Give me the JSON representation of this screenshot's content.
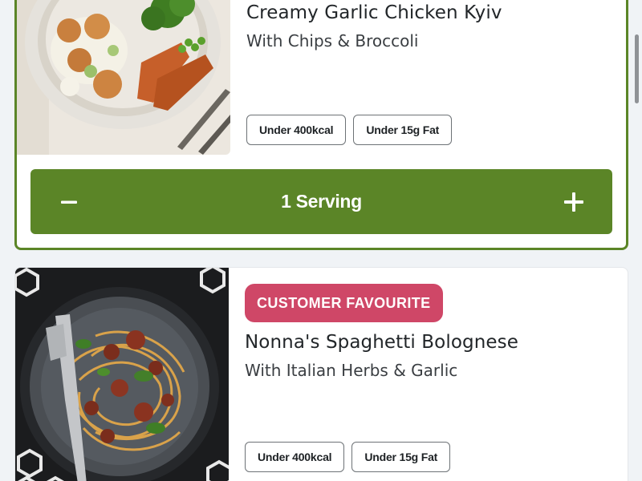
{
  "meals": [
    {
      "image_icon": "chicken-kyiv-plate-image",
      "title": "Creamy Garlic Chicken Kyiv",
      "subtitle": "With Chips & Broccoli",
      "tags": [
        "Under 400kcal",
        "Under 15g Fat"
      ],
      "selected": true,
      "servings_label": "1 Serving"
    },
    {
      "image_icon": "spaghetti-bolognese-plate-image",
      "badge": "CUSTOMER FAVOURITE",
      "title": "Nonna's Spaghetti Bolognese",
      "subtitle": "With Italian Herbs & Garlic",
      "tags": [
        "Under 400kcal",
        "Under 15g Fat"
      ],
      "selected": false
    }
  ],
  "icons": {
    "decrease": "minus-icon",
    "increase": "plus-icon"
  },
  "colors": {
    "accent_green": "#5b8527",
    "badge_pink": "#cf4767",
    "page_background": "#f0f3f6"
  }
}
